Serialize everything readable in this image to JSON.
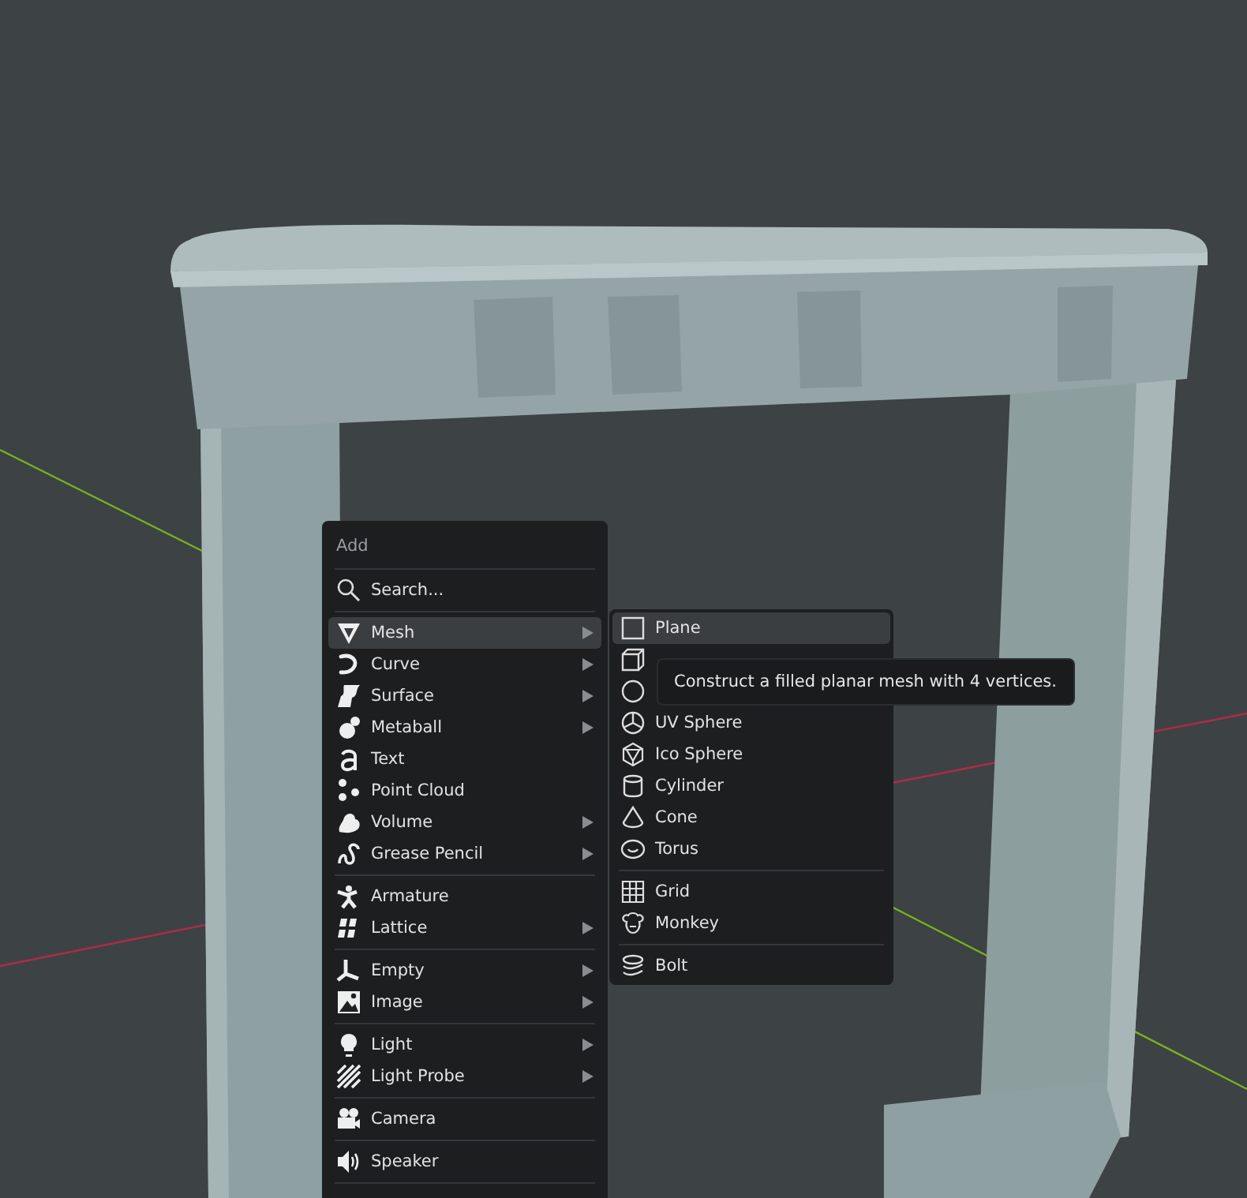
{
  "menu": {
    "title": "Add",
    "search": "Search...",
    "groups": [
      [
        {
          "label": "Mesh",
          "submenu": true,
          "selected": true
        },
        {
          "label": "Curve",
          "submenu": true,
          "selected": false
        },
        {
          "label": "Surface",
          "submenu": true,
          "selected": false
        },
        {
          "label": "Metaball",
          "submenu": true,
          "selected": false
        },
        {
          "label": "Text",
          "submenu": false,
          "selected": false
        },
        {
          "label": "Point Cloud",
          "submenu": false,
          "selected": false
        },
        {
          "label": "Volume",
          "submenu": true,
          "selected": false
        },
        {
          "label": "Grease Pencil",
          "submenu": true,
          "selected": false
        }
      ],
      [
        {
          "label": "Armature",
          "submenu": false,
          "selected": false
        },
        {
          "label": "Lattice",
          "submenu": true,
          "selected": false
        }
      ],
      [
        {
          "label": "Empty",
          "submenu": true,
          "selected": false
        },
        {
          "label": "Image",
          "submenu": true,
          "selected": false
        }
      ],
      [
        {
          "label": "Light",
          "submenu": true,
          "selected": false
        },
        {
          "label": "Light Probe",
          "submenu": true,
          "selected": false
        }
      ],
      [
        {
          "label": "Camera",
          "submenu": false,
          "selected": false
        }
      ],
      [
        {
          "label": "Speaker",
          "submenu": false,
          "selected": false
        }
      ]
    ]
  },
  "submenu": {
    "groups": [
      [
        {
          "label": "Plane",
          "selected": true
        },
        {
          "selected": false
        },
        {
          "selected": false
        },
        {
          "label": "UV Sphere",
          "selected": false
        },
        {
          "label": "Ico Sphere",
          "selected": false
        },
        {
          "label": "Cylinder",
          "selected": false
        },
        {
          "label": "Cone",
          "selected": false
        },
        {
          "label": "Torus",
          "selected": false
        }
      ],
      [
        {
          "label": "Grid",
          "selected": false
        },
        {
          "label": "Monkey",
          "selected": false
        }
      ],
      [
        {
          "label": "Bolt",
          "selected": false
        }
      ]
    ]
  },
  "tooltip": {
    "text": "Construct a filled planar mesh with 4 vertices."
  }
}
